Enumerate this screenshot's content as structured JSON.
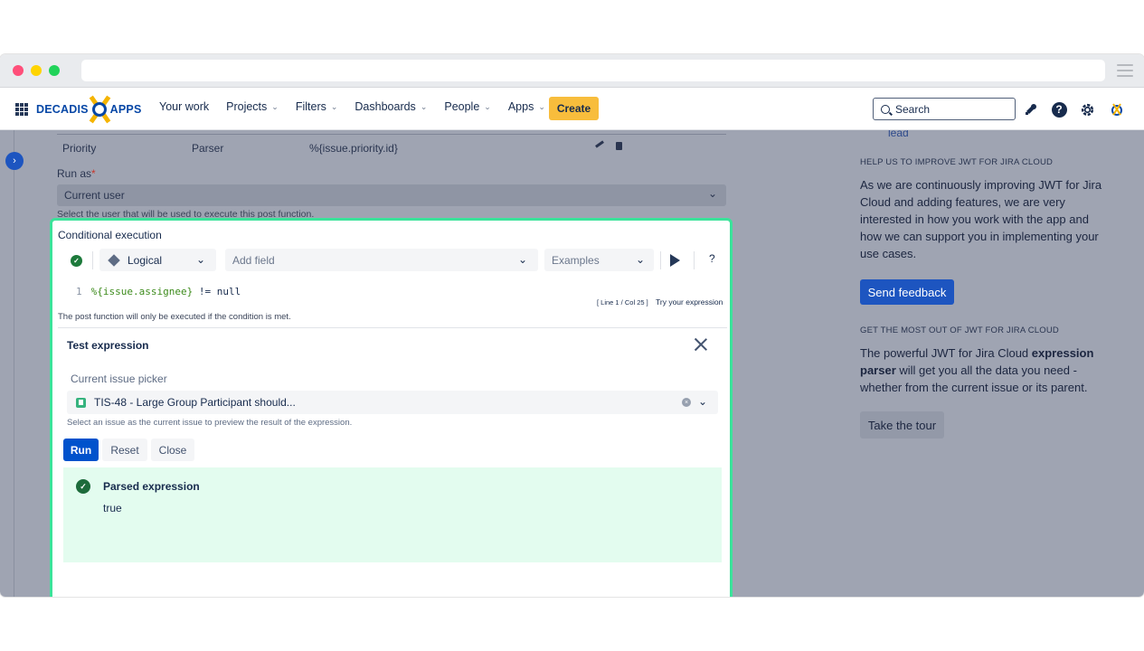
{
  "nav": {
    "logo_left": "DECADIS",
    "logo_right": "APPS",
    "items": [
      {
        "label": "Your work",
        "dropdown": false
      },
      {
        "label": "Projects",
        "dropdown": true
      },
      {
        "label": "Filters",
        "dropdown": true
      },
      {
        "label": "Dashboards",
        "dropdown": true
      },
      {
        "label": "People",
        "dropdown": true
      },
      {
        "label": "Apps",
        "dropdown": true
      }
    ],
    "create_label": "Create",
    "search_placeholder": "Search"
  },
  "background_form": {
    "row": {
      "name": "Priority",
      "type": "Parser",
      "value": "%{issue.priority.id}"
    },
    "run_as_label": "Run as",
    "run_as_value": "Current user",
    "run_as_help": "Select the user that will be used to execute this post function."
  },
  "conditional": {
    "title": "Conditional execution",
    "toolbar": {
      "parser_mode": "Logical",
      "add_field_placeholder": "Add field",
      "examples_placeholder": "Examples",
      "help": "?"
    },
    "code": {
      "line_number": "1",
      "variable": "%{issue.assignee}",
      "rest": " != null"
    },
    "cursor_info": "[ Line 1 / Col 25 ]",
    "try_link": "Try your expression",
    "help_text": "The post function will only be executed if the condition is met."
  },
  "test_expression": {
    "title": "Test expression",
    "picker_label": "Current issue picker",
    "picker_value": "TIS-48 - Large Group Participant should...",
    "picker_help": "Select an issue as the current issue to preview the result of the expression.",
    "buttons": {
      "run": "Run",
      "reset": "Reset",
      "close": "Close"
    },
    "result": {
      "title": "Parsed expression",
      "value": "true"
    }
  },
  "sidebar": {
    "lead_fragment": "lead",
    "help_heading": "HELP US TO IMPROVE JWT FOR JIRA CLOUD",
    "help_text": "As we are continuously improving JWT for Jira Cloud and adding features, we are very interested in how you work with the app and how we can support you in implementing your use cases.",
    "feedback_button": "Send feedback",
    "most_heading": "GET THE MOST OUT OF JWT FOR JIRA CLOUD",
    "most_text_1": "The powerful JWT for Jira Cloud ",
    "most_text_bold": "expression parser",
    "most_text_2": " will get you all the data you need - whether from the current issue or its parent.",
    "tour_button": "Take the tour"
  },
  "colors": {
    "accent_green": "#3be39a",
    "primary_blue": "#0052cc",
    "create_yellow": "#f8bd3c"
  }
}
